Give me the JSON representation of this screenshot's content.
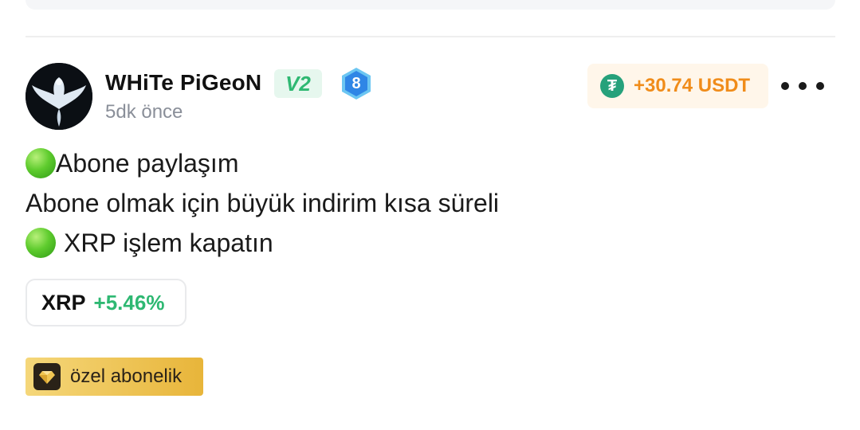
{
  "post": {
    "author": {
      "name": "WHiTe PiGeoN",
      "level": "V2",
      "rank": "8",
      "avatar_icon": "white-pigeon-avatar"
    },
    "timestamp": "5dk önce",
    "pnl": {
      "icon": "tether-icon",
      "value": "+30.74 USDT",
      "color": "#f08c1a"
    },
    "more_icon": "more-horizontal-icon",
    "content": {
      "line1": "Abone paylaşım",
      "line2": "Abone olmak için büyük indirim kısa süreli",
      "line3": "XRP işlem kapatın"
    },
    "coin_tag": {
      "symbol": "XRP",
      "change": "+5.46%",
      "change_color": "#2eb872"
    },
    "premium": {
      "icon": "diamond-icon",
      "label": "özel abonelik"
    }
  }
}
